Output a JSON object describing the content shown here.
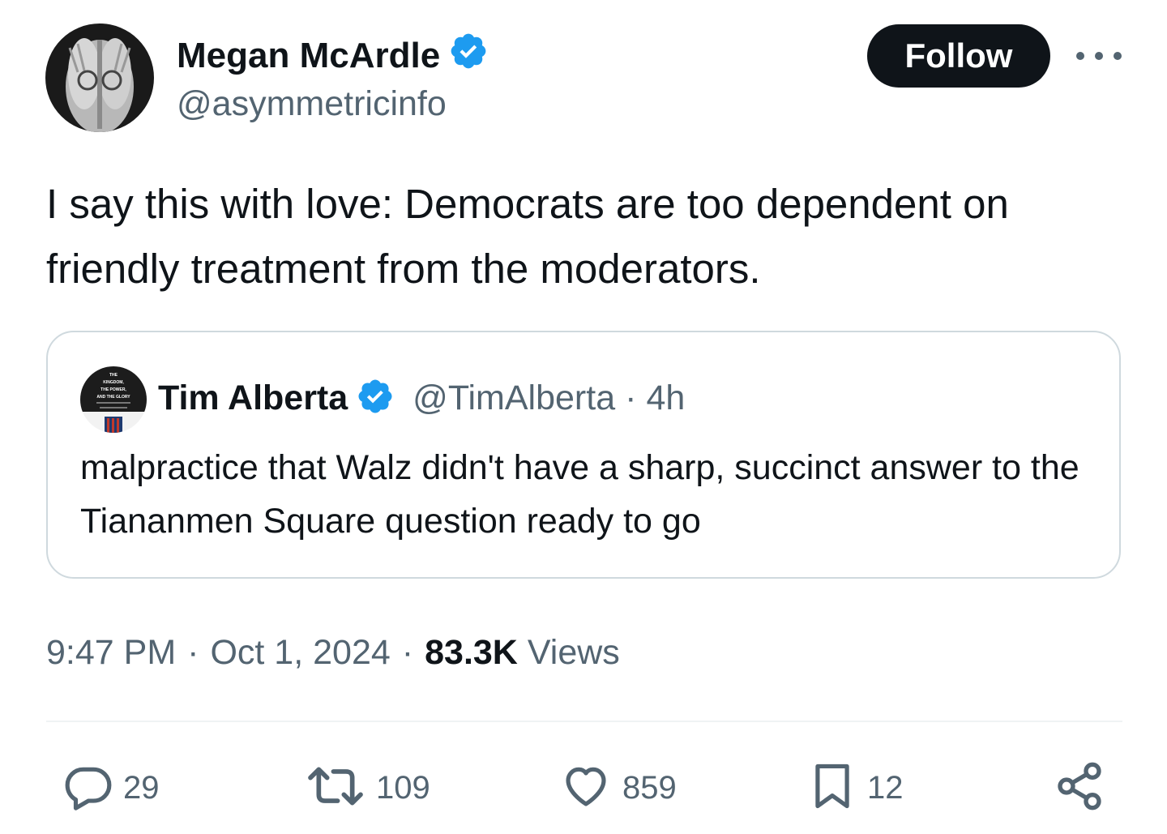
{
  "author": {
    "name": "Megan McArdle",
    "handle": "@asymmetricinfo",
    "verified": true
  },
  "follow_label": "Follow",
  "tweet_text": "I say this with love: Democrats are too dependent on friendly treatment from the moderators.",
  "quote": {
    "name": "Tim Alberta",
    "handle": "@TimAlberta",
    "separator": "·",
    "time": "4h",
    "verified": true,
    "text": "malpractice that Walz didn't have a sharp, succinct answer to the Tiananmen Square question ready to go",
    "avatar_text": [
      "THE",
      "KINGDOM,",
      "THE POWER,",
      "AND THE GLORY"
    ]
  },
  "meta": {
    "time": "9:47 PM",
    "sep1": "·",
    "date": "Oct 1, 2024",
    "sep2": "·",
    "views_count": "83.3K",
    "views_label": "Views"
  },
  "actions": {
    "replies": "29",
    "reposts": "109",
    "likes": "859",
    "bookmarks": "12"
  },
  "colors": {
    "text": "#0f1419",
    "secondary": "#536471",
    "verified": "#1d9bf0",
    "border": "#cfd9de"
  },
  "icons": [
    "verified-badge-icon",
    "more-icon",
    "reply-icon",
    "repost-icon",
    "like-icon",
    "bookmark-icon",
    "share-icon"
  ]
}
